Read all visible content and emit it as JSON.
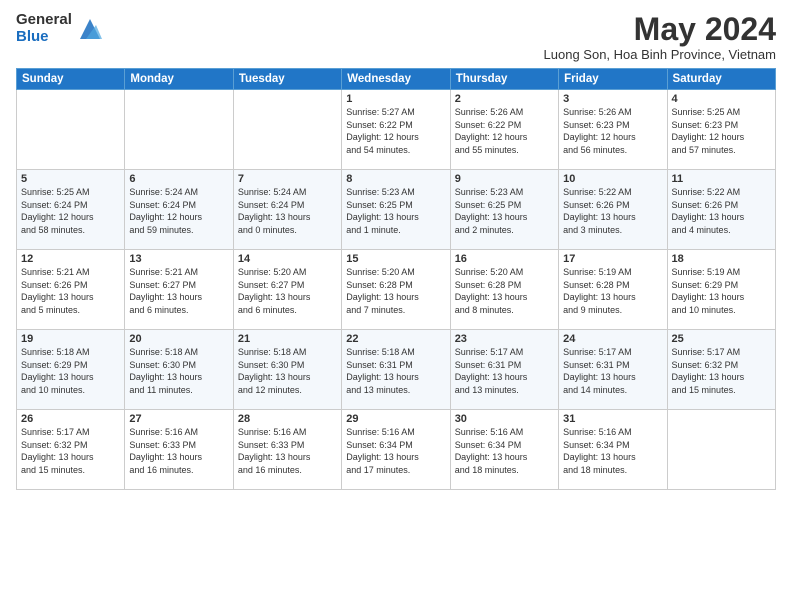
{
  "logo": {
    "general": "General",
    "blue": "Blue"
  },
  "header": {
    "title": "May 2024",
    "subtitle": "Luong Son, Hoa Binh Province, Vietnam"
  },
  "days_of_week": [
    "Sunday",
    "Monday",
    "Tuesday",
    "Wednesday",
    "Thursday",
    "Friday",
    "Saturday"
  ],
  "weeks": [
    [
      {
        "day": "",
        "info": ""
      },
      {
        "day": "",
        "info": ""
      },
      {
        "day": "",
        "info": ""
      },
      {
        "day": "1",
        "info": "Sunrise: 5:27 AM\nSunset: 6:22 PM\nDaylight: 12 hours\nand 54 minutes."
      },
      {
        "day": "2",
        "info": "Sunrise: 5:26 AM\nSunset: 6:22 PM\nDaylight: 12 hours\nand 55 minutes."
      },
      {
        "day": "3",
        "info": "Sunrise: 5:26 AM\nSunset: 6:23 PM\nDaylight: 12 hours\nand 56 minutes."
      },
      {
        "day": "4",
        "info": "Sunrise: 5:25 AM\nSunset: 6:23 PM\nDaylight: 12 hours\nand 57 minutes."
      }
    ],
    [
      {
        "day": "5",
        "info": "Sunrise: 5:25 AM\nSunset: 6:24 PM\nDaylight: 12 hours\nand 58 minutes."
      },
      {
        "day": "6",
        "info": "Sunrise: 5:24 AM\nSunset: 6:24 PM\nDaylight: 12 hours\nand 59 minutes."
      },
      {
        "day": "7",
        "info": "Sunrise: 5:24 AM\nSunset: 6:24 PM\nDaylight: 13 hours\nand 0 minutes."
      },
      {
        "day": "8",
        "info": "Sunrise: 5:23 AM\nSunset: 6:25 PM\nDaylight: 13 hours\nand 1 minute."
      },
      {
        "day": "9",
        "info": "Sunrise: 5:23 AM\nSunset: 6:25 PM\nDaylight: 13 hours\nand 2 minutes."
      },
      {
        "day": "10",
        "info": "Sunrise: 5:22 AM\nSunset: 6:26 PM\nDaylight: 13 hours\nand 3 minutes."
      },
      {
        "day": "11",
        "info": "Sunrise: 5:22 AM\nSunset: 6:26 PM\nDaylight: 13 hours\nand 4 minutes."
      }
    ],
    [
      {
        "day": "12",
        "info": "Sunrise: 5:21 AM\nSunset: 6:26 PM\nDaylight: 13 hours\nand 5 minutes."
      },
      {
        "day": "13",
        "info": "Sunrise: 5:21 AM\nSunset: 6:27 PM\nDaylight: 13 hours\nand 6 minutes."
      },
      {
        "day": "14",
        "info": "Sunrise: 5:20 AM\nSunset: 6:27 PM\nDaylight: 13 hours\nand 6 minutes."
      },
      {
        "day": "15",
        "info": "Sunrise: 5:20 AM\nSunset: 6:28 PM\nDaylight: 13 hours\nand 7 minutes."
      },
      {
        "day": "16",
        "info": "Sunrise: 5:20 AM\nSunset: 6:28 PM\nDaylight: 13 hours\nand 8 minutes."
      },
      {
        "day": "17",
        "info": "Sunrise: 5:19 AM\nSunset: 6:28 PM\nDaylight: 13 hours\nand 9 minutes."
      },
      {
        "day": "18",
        "info": "Sunrise: 5:19 AM\nSunset: 6:29 PM\nDaylight: 13 hours\nand 10 minutes."
      }
    ],
    [
      {
        "day": "19",
        "info": "Sunrise: 5:18 AM\nSunset: 6:29 PM\nDaylight: 13 hours\nand 10 minutes."
      },
      {
        "day": "20",
        "info": "Sunrise: 5:18 AM\nSunset: 6:30 PM\nDaylight: 13 hours\nand 11 minutes."
      },
      {
        "day": "21",
        "info": "Sunrise: 5:18 AM\nSunset: 6:30 PM\nDaylight: 13 hours\nand 12 minutes."
      },
      {
        "day": "22",
        "info": "Sunrise: 5:18 AM\nSunset: 6:31 PM\nDaylight: 13 hours\nand 13 minutes."
      },
      {
        "day": "23",
        "info": "Sunrise: 5:17 AM\nSunset: 6:31 PM\nDaylight: 13 hours\nand 13 minutes."
      },
      {
        "day": "24",
        "info": "Sunrise: 5:17 AM\nSunset: 6:31 PM\nDaylight: 13 hours\nand 14 minutes."
      },
      {
        "day": "25",
        "info": "Sunrise: 5:17 AM\nSunset: 6:32 PM\nDaylight: 13 hours\nand 15 minutes."
      }
    ],
    [
      {
        "day": "26",
        "info": "Sunrise: 5:17 AM\nSunset: 6:32 PM\nDaylight: 13 hours\nand 15 minutes."
      },
      {
        "day": "27",
        "info": "Sunrise: 5:16 AM\nSunset: 6:33 PM\nDaylight: 13 hours\nand 16 minutes."
      },
      {
        "day": "28",
        "info": "Sunrise: 5:16 AM\nSunset: 6:33 PM\nDaylight: 13 hours\nand 16 minutes."
      },
      {
        "day": "29",
        "info": "Sunrise: 5:16 AM\nSunset: 6:34 PM\nDaylight: 13 hours\nand 17 minutes."
      },
      {
        "day": "30",
        "info": "Sunrise: 5:16 AM\nSunset: 6:34 PM\nDaylight: 13 hours\nand 18 minutes."
      },
      {
        "day": "31",
        "info": "Sunrise: 5:16 AM\nSunset: 6:34 PM\nDaylight: 13 hours\nand 18 minutes."
      },
      {
        "day": "",
        "info": ""
      }
    ]
  ]
}
